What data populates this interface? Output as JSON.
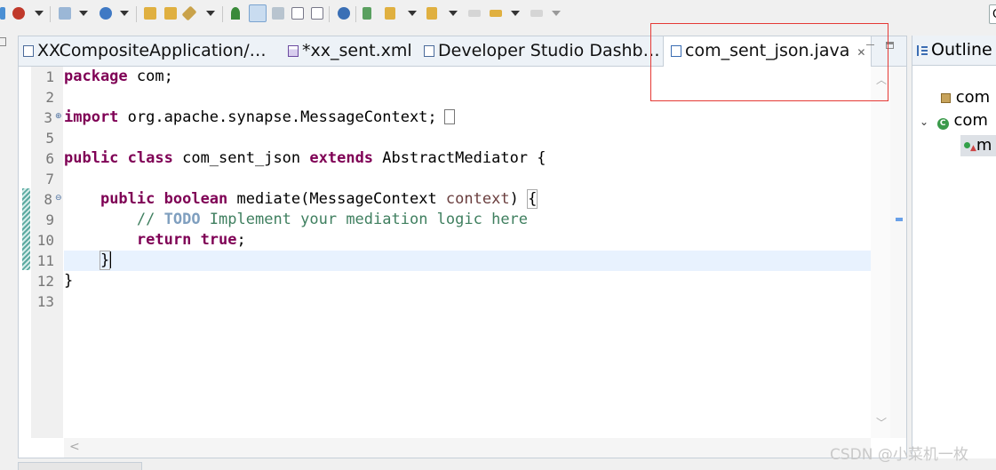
{
  "toolbar": {
    "icons": [
      "debug-icon",
      "run-icon",
      "new-server-icon",
      "new-service-icon",
      "open-type-icon",
      "open-resource-icon",
      "search-icon",
      "pin-icon",
      "mark-occurrences-icon",
      "block-selection-icon",
      "toggle-whitespace-icon",
      "show-whitespace-icon",
      "globe-icon",
      "next-annotation-icon",
      "prev-annotation-icon",
      "back-icon",
      "forward-icon"
    ]
  },
  "editor": {
    "tabs": [
      {
        "label": "XXCompositeApplication/…",
        "icon": "project-icon"
      },
      {
        "label": "*xx_sent.xml",
        "icon": "xml-file-icon"
      },
      {
        "label": "Developer Studio Dashb…",
        "icon": "dashboard-icon"
      },
      {
        "label": "com_sent_json.java",
        "icon": "java-file-icon",
        "active": true
      }
    ],
    "line_numbers": [
      "1",
      "2",
      "3",
      "5",
      "6",
      "7",
      "8",
      "9",
      "10",
      "11",
      "12",
      "13"
    ],
    "code": {
      "l1_kw": "package",
      "l1_rest": " com;",
      "l3_kw": "import",
      "l3_rest": " org.apache.synapse.MessageContext;",
      "l6_kw1": "public",
      "l6_kw2": "class",
      "l6_name": " com_sent_json ",
      "l6_kw3": "extends",
      "l6_rest": " AbstractMediator {",
      "l8_indent": "    ",
      "l8_kw1": "public",
      "l8_kw2": "boolean",
      "l8_name": " mediate(MessageContext ",
      "l8_param": "context",
      "l8_close": ") ",
      "l8_brace": "{",
      "l9_indent": "        ",
      "l9_comment": "// ",
      "l9_todo": "TODO",
      "l9_rest": " Implement your mediation logic here",
      "l10_indent": "        ",
      "l10_kw1": "return",
      "l10_kw2": "true",
      "l10_rest": ";",
      "l11_indent": "    ",
      "l11_brace": "}",
      "l12_brace": "}"
    }
  },
  "outline": {
    "title": "Outline",
    "items": [
      "com",
      "com",
      "m"
    ]
  },
  "watermark": "CSDN @小菜机一枚",
  "colors": {
    "keyword": "#7f0055",
    "comment": "#3f7f5f",
    "todo": "#7f9fbf",
    "highlight": "#e53935"
  }
}
